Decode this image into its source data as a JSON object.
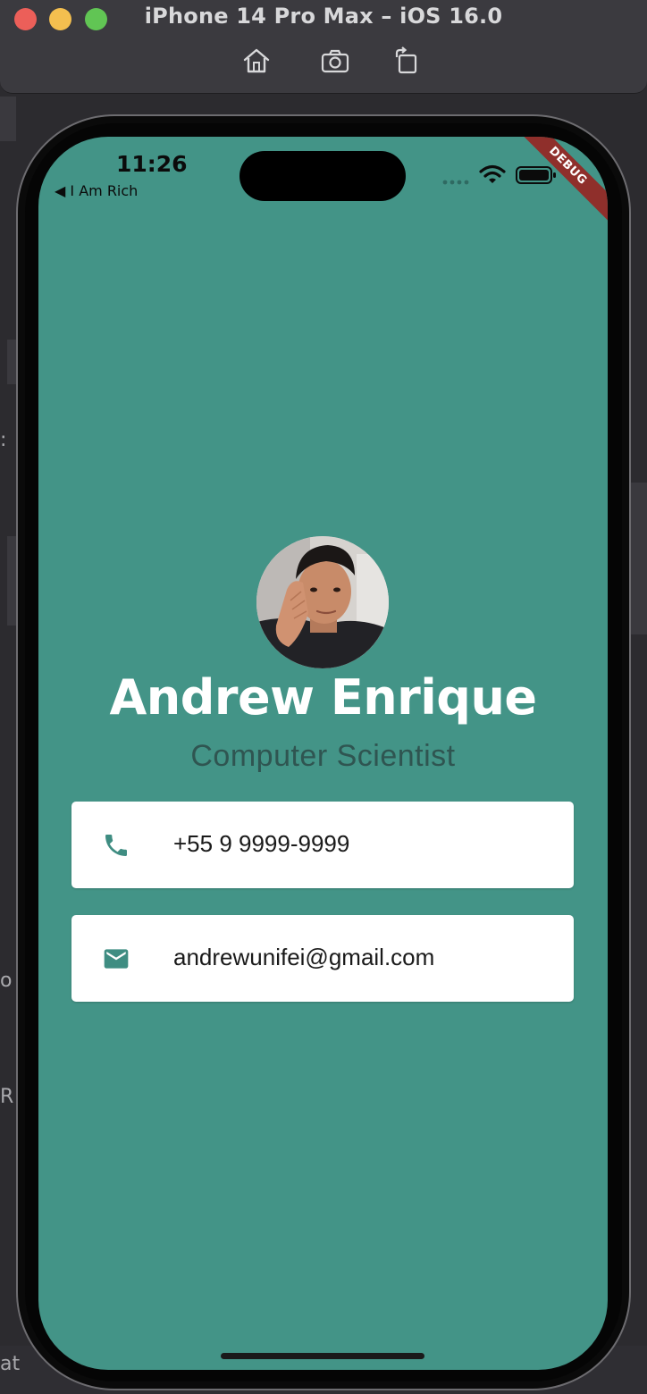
{
  "window": {
    "title": "iPhone 14 Pro Max – iOS 16.0",
    "toolbar_icons": [
      "home-icon",
      "screenshot-icon",
      "rotate-icon"
    ]
  },
  "status_bar": {
    "time": "11:26",
    "back_app": "◀ I Am Rich",
    "debug_label": "DEBUG"
  },
  "profile": {
    "name": "Andrew Enrique",
    "title": "Computer Scientist"
  },
  "contacts": [
    {
      "icon": "phone-icon",
      "value": "+55 9 9999-9999"
    },
    {
      "icon": "email-icon",
      "value": "andrewunifei@gmail.com"
    }
  ],
  "colors": {
    "background": "#439487",
    "subtitle": "#2f5551",
    "icon_accent": "#3f8d82",
    "card": "#ffffff",
    "debug_banner": "#8f2f2b"
  },
  "edge_fragments": {
    "a": "o",
    "b": "R",
    "c": "at",
    "d": ":"
  }
}
